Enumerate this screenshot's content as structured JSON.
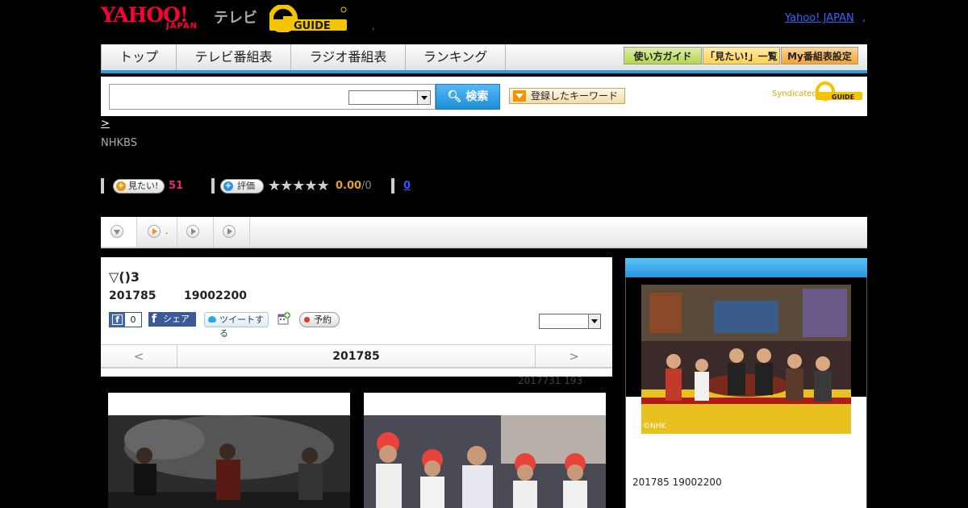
{
  "header": {
    "logo_yahoo": "YAHOO!",
    "logo_japan": "JAPAN",
    "logo_tv": "テレビ",
    "logo_gguide": "G GUIDE",
    "dot": ",",
    "yahoo_link": "Yahoo! JAPAN",
    "yahoo_link_dot": ","
  },
  "nav": {
    "tabs": [
      "トップ",
      "テレビ番組表",
      "ラジオ番組表",
      "ランキング"
    ],
    "buttons": [
      "使い方ガイド",
      "「見たい!」一覧",
      "My番組表設定"
    ],
    "button_colors": [
      "#b6d84a",
      "#ffd24a",
      "#f7a42a"
    ]
  },
  "search": {
    "input_value": "",
    "select_value": "",
    "button_label": "検索",
    "keyword_button": "登録したキーワード",
    "syndicated": "Syndicated"
  },
  "program_meta": {
    "breadcrumb": ">",
    "channel": "NHKBS",
    "want_label": "見たい!",
    "want_count": "51",
    "rate_label": "評価",
    "stars": "★★★★★",
    "rating_score": "0.00",
    "rating_total": "/0",
    "review_count": "0"
  },
  "tab_strip": {
    "second_tab_label": "."
  },
  "program": {
    "title": "▽()3",
    "date": "201785",
    "time": "19002200",
    "fb_like_count": "0",
    "fb_share": "シェア",
    "tweet": "ツイートする",
    "reserve": "予約",
    "select_value": "",
    "prev": "<",
    "current_date": "201785",
    "next": ">",
    "update_note": "2017731  193"
  },
  "side": {
    "image_credit": "©NHK",
    "info": "201785  19002200"
  }
}
